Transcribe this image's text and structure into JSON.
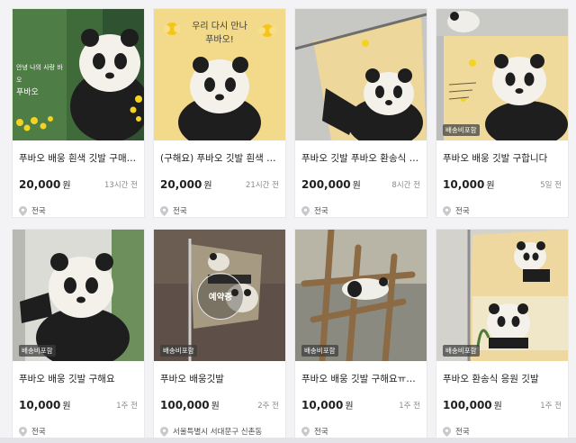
{
  "listings": [
    {
      "title": "푸바오 배웅 흰색 깃발 구매…",
      "price": "20,000",
      "currency": "원",
      "time": "13시간 전",
      "location": "전국",
      "badge": "",
      "reserved": "",
      "image_text": [
        "안녕 나의 사랑 바오",
        "푸바오"
      ]
    },
    {
      "title": "(구해요) 푸바오 깃발 흰색 구…",
      "price": "20,000",
      "currency": "원",
      "time": "21시간 전",
      "location": "전국",
      "badge": "",
      "reserved": "",
      "image_text": [
        "우리 다시 만나",
        "푸바오!"
      ]
    },
    {
      "title": "푸바오 깃발 푸바오 환송식 …",
      "price": "200,000",
      "currency": "원",
      "time": "8시간 전",
      "location": "전국",
      "badge": "",
      "reserved": "",
      "image_text": []
    },
    {
      "title": "푸바오 배웅 깃발 구합니다",
      "price": "10,000",
      "currency": "원",
      "time": "5일 전",
      "location": "전국",
      "badge": "배송비포함",
      "reserved": "",
      "image_text": []
    },
    {
      "title": "푸바오 배웅 깃발 구해요",
      "price": "10,000",
      "currency": "원",
      "time": "1주 전",
      "location": "전국",
      "badge": "배송비포함",
      "reserved": "",
      "image_text": []
    },
    {
      "title": "푸바오 배웅깃발",
      "price": "100,000",
      "currency": "원",
      "time": "2주 전",
      "location": "서울특별시 서대문구 신촌동",
      "badge": "배송비포함",
      "reserved": "예약중",
      "image_text": []
    },
    {
      "title": "푸바오 배웅 깃발 구해요ㅠㅠㅠ",
      "price": "10,000",
      "currency": "원",
      "time": "1주 전",
      "location": "전국",
      "badge": "배송비포함",
      "reserved": "",
      "image_text": []
    },
    {
      "title": "푸바오 환송식 응원 깃발",
      "price": "100,000",
      "currency": "원",
      "time": "1주 전",
      "location": "전국",
      "badge": "배송비포함",
      "reserved": "",
      "image_text": []
    }
  ],
  "colors": {
    "accent": "#212124",
    "flag_yellow": "#f3d98a",
    "flower_yellow": "#f5d321"
  }
}
